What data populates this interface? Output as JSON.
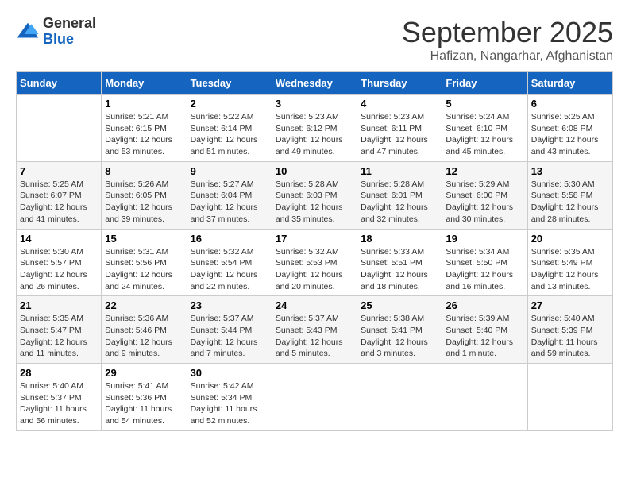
{
  "header": {
    "logo": {
      "general": "General",
      "blue": "Blue"
    },
    "title": "September 2025",
    "location": "Hafizan, Nangarhar, Afghanistan"
  },
  "calendar": {
    "days_of_week": [
      "Sunday",
      "Monday",
      "Tuesday",
      "Wednesday",
      "Thursday",
      "Friday",
      "Saturday"
    ],
    "weeks": [
      [
        {
          "day": "",
          "info": ""
        },
        {
          "day": "1",
          "info": "Sunrise: 5:21 AM\nSunset: 6:15 PM\nDaylight: 12 hours\nand 53 minutes."
        },
        {
          "day": "2",
          "info": "Sunrise: 5:22 AM\nSunset: 6:14 PM\nDaylight: 12 hours\nand 51 minutes."
        },
        {
          "day": "3",
          "info": "Sunrise: 5:23 AM\nSunset: 6:12 PM\nDaylight: 12 hours\nand 49 minutes."
        },
        {
          "day": "4",
          "info": "Sunrise: 5:23 AM\nSunset: 6:11 PM\nDaylight: 12 hours\nand 47 minutes."
        },
        {
          "day": "5",
          "info": "Sunrise: 5:24 AM\nSunset: 6:10 PM\nDaylight: 12 hours\nand 45 minutes."
        },
        {
          "day": "6",
          "info": "Sunrise: 5:25 AM\nSunset: 6:08 PM\nDaylight: 12 hours\nand 43 minutes."
        }
      ],
      [
        {
          "day": "7",
          "info": "Sunrise: 5:25 AM\nSunset: 6:07 PM\nDaylight: 12 hours\nand 41 minutes."
        },
        {
          "day": "8",
          "info": "Sunrise: 5:26 AM\nSunset: 6:05 PM\nDaylight: 12 hours\nand 39 minutes."
        },
        {
          "day": "9",
          "info": "Sunrise: 5:27 AM\nSunset: 6:04 PM\nDaylight: 12 hours\nand 37 minutes."
        },
        {
          "day": "10",
          "info": "Sunrise: 5:28 AM\nSunset: 6:03 PM\nDaylight: 12 hours\nand 35 minutes."
        },
        {
          "day": "11",
          "info": "Sunrise: 5:28 AM\nSunset: 6:01 PM\nDaylight: 12 hours\nand 32 minutes."
        },
        {
          "day": "12",
          "info": "Sunrise: 5:29 AM\nSunset: 6:00 PM\nDaylight: 12 hours\nand 30 minutes."
        },
        {
          "day": "13",
          "info": "Sunrise: 5:30 AM\nSunset: 5:58 PM\nDaylight: 12 hours\nand 28 minutes."
        }
      ],
      [
        {
          "day": "14",
          "info": "Sunrise: 5:30 AM\nSunset: 5:57 PM\nDaylight: 12 hours\nand 26 minutes."
        },
        {
          "day": "15",
          "info": "Sunrise: 5:31 AM\nSunset: 5:56 PM\nDaylight: 12 hours\nand 24 minutes."
        },
        {
          "day": "16",
          "info": "Sunrise: 5:32 AM\nSunset: 5:54 PM\nDaylight: 12 hours\nand 22 minutes."
        },
        {
          "day": "17",
          "info": "Sunrise: 5:32 AM\nSunset: 5:53 PM\nDaylight: 12 hours\nand 20 minutes."
        },
        {
          "day": "18",
          "info": "Sunrise: 5:33 AM\nSunset: 5:51 PM\nDaylight: 12 hours\nand 18 minutes."
        },
        {
          "day": "19",
          "info": "Sunrise: 5:34 AM\nSunset: 5:50 PM\nDaylight: 12 hours\nand 16 minutes."
        },
        {
          "day": "20",
          "info": "Sunrise: 5:35 AM\nSunset: 5:49 PM\nDaylight: 12 hours\nand 13 minutes."
        }
      ],
      [
        {
          "day": "21",
          "info": "Sunrise: 5:35 AM\nSunset: 5:47 PM\nDaylight: 12 hours\nand 11 minutes."
        },
        {
          "day": "22",
          "info": "Sunrise: 5:36 AM\nSunset: 5:46 PM\nDaylight: 12 hours\nand 9 minutes."
        },
        {
          "day": "23",
          "info": "Sunrise: 5:37 AM\nSunset: 5:44 PM\nDaylight: 12 hours\nand 7 minutes."
        },
        {
          "day": "24",
          "info": "Sunrise: 5:37 AM\nSunset: 5:43 PM\nDaylight: 12 hours\nand 5 minutes."
        },
        {
          "day": "25",
          "info": "Sunrise: 5:38 AM\nSunset: 5:41 PM\nDaylight: 12 hours\nand 3 minutes."
        },
        {
          "day": "26",
          "info": "Sunrise: 5:39 AM\nSunset: 5:40 PM\nDaylight: 12 hours\nand 1 minute."
        },
        {
          "day": "27",
          "info": "Sunrise: 5:40 AM\nSunset: 5:39 PM\nDaylight: 11 hours\nand 59 minutes."
        }
      ],
      [
        {
          "day": "28",
          "info": "Sunrise: 5:40 AM\nSunset: 5:37 PM\nDaylight: 11 hours\nand 56 minutes."
        },
        {
          "day": "29",
          "info": "Sunrise: 5:41 AM\nSunset: 5:36 PM\nDaylight: 11 hours\nand 54 minutes."
        },
        {
          "day": "30",
          "info": "Sunrise: 5:42 AM\nSunset: 5:34 PM\nDaylight: 11 hours\nand 52 minutes."
        },
        {
          "day": "",
          "info": ""
        },
        {
          "day": "",
          "info": ""
        },
        {
          "day": "",
          "info": ""
        },
        {
          "day": "",
          "info": ""
        }
      ]
    ]
  }
}
